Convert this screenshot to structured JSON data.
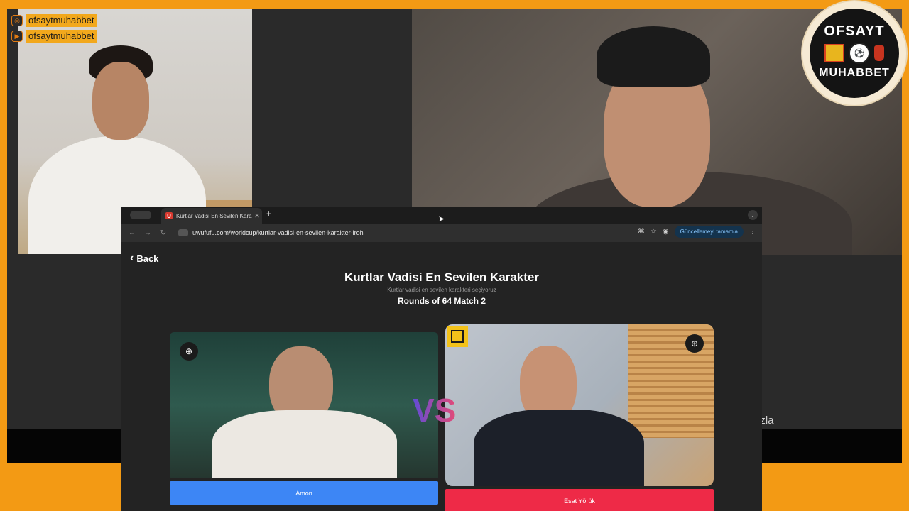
{
  "overlay": {
    "social": [
      {
        "icon": "instagram-icon",
        "handle": "ofsaytmuhabbet"
      },
      {
        "icon": "youtube-icon",
        "handle": "ofsaytmuhabbet"
      }
    ],
    "logo": {
      "top_text": "OFSAYT",
      "bottom_text": "MUHABBET"
    },
    "right_tail": {
      "line1": ")",
      "line2": "azla"
    }
  },
  "browser": {
    "tab_title": "Kurtlar Vadisi En Sevilen Karakter",
    "url": "uwufufu.com/worldcup/kurtlar-vadisi-en-sevilen-karakter-iroh",
    "update_button": "Güncellemeyi tamamla"
  },
  "page": {
    "back_label": "Back",
    "title": "Kurtlar Vadisi En Sevilen Karakter",
    "subtitle": "Kurtlar vadisi en sevilen karakteri seçiyoruz",
    "round_info": "Rounds of 64 Match 2",
    "vs_text": "VS",
    "candidate_left": "Amon",
    "candidate_right": "Esat Yörük"
  },
  "colors": {
    "frame_orange": "#f39a14",
    "left_button": "#3d86f5",
    "right_button": "#ee2a47"
  }
}
